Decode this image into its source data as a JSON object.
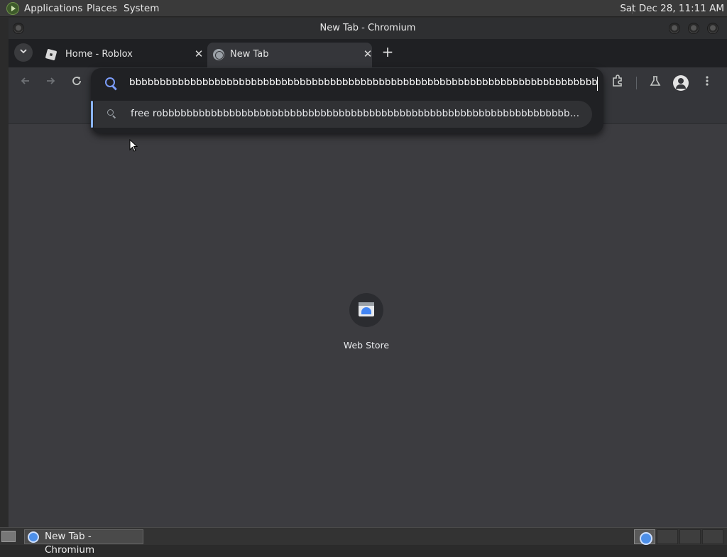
{
  "top_panel": {
    "menus": [
      "Applications",
      "Places",
      "System"
    ],
    "clock": "Sat Dec 28, 11:11 AM"
  },
  "window": {
    "title": "New Tab - Chromium"
  },
  "tabs": [
    {
      "label": "Home - Roblox",
      "active": false
    },
    {
      "label": "New Tab",
      "active": true
    }
  ],
  "omnibox": {
    "input_value": "bbbbbbbbbbbbbbbbbbbbbbbbbbbbbbbbbbbbbbbbbbbbbbbbbbbbbbbbbbbbbbbbbbbbbbbbbbbbbbbbbbbbbb",
    "suggestion": "free robbbbbbbbbbbbbbbbbbbbbbbbbbbbbbbbbbbbbbbbbbbbbbbbbbbbbbbbbbbbbbbbbbbbbbbbbbbbbbbbbbbbbbbbbbbbbbbbbbbbbbbbbbbbbbbbbbb"
  },
  "new_tab_page": {
    "shortcut_title": "Web Store"
  },
  "taskbar": {
    "task_label": "New Tab - Chromium"
  },
  "icons": {
    "back": "arrow-left-icon",
    "forward": "arrow-right-icon",
    "reload": "reload-icon",
    "extensions": "puzzle-icon",
    "labs": "flask-icon",
    "profile": "person-icon",
    "menu": "kebab-menu-icon"
  },
  "colors": {
    "accent": "#8ab4f8",
    "search_icon": "#7b9cf9",
    "content_bg": "#3c3c40",
    "toolbar_bg": "#35363a"
  }
}
